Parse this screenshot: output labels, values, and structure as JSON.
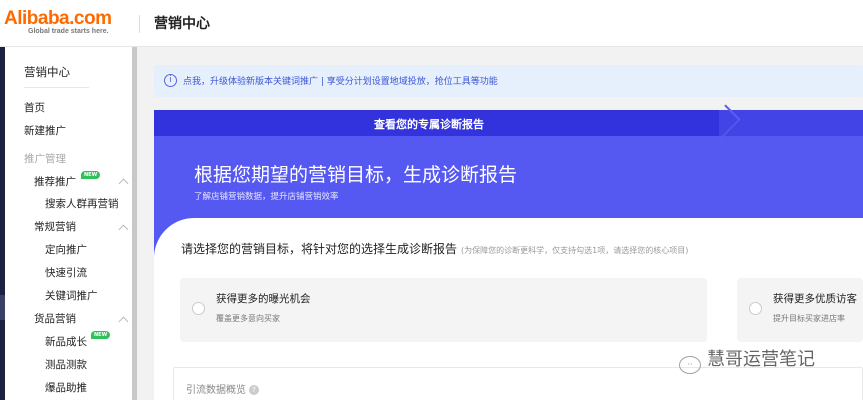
{
  "header": {
    "logo_brand": "Alibaba.com",
    "logo_tagline": "Global trade starts here.",
    "title": "营销中心"
  },
  "sidebar": {
    "title": "营销中心",
    "items": [
      {
        "label": "首页"
      },
      {
        "label": "新建推广"
      },
      {
        "label": "推广管理"
      },
      {
        "label": "推荐推广",
        "badge": "NEW"
      },
      {
        "label": "搜索人群再营销"
      },
      {
        "label": "常规营销"
      },
      {
        "label": "定向推广"
      },
      {
        "label": "快速引流"
      },
      {
        "label": "关键词推广"
      },
      {
        "label": "货品营销"
      },
      {
        "label": "新品成长",
        "badge": "NEW"
      },
      {
        "label": "测品测款"
      },
      {
        "label": "爆品助推"
      }
    ]
  },
  "banner": {
    "text": "点我，升级体验新版本关键词推广 | 享受分计划设置地域投放，抢位工具等功能"
  },
  "card": {
    "step_label": "查看您的专属诊断报告",
    "heading": "根据您期望的营销目标，生成诊断报告",
    "subheading": "了解店铺营销数据，提升店铺营销效率",
    "prompt": "请选择您的营销目标，将针对您的选择生成诊断报告",
    "prompt_note": "(为保障您的诊断更科学，仅支持勾选1项，请选择您的核心项目)",
    "options": [
      {
        "title": "获得更多的曝光机会",
        "desc": "覆盖更多意向买家"
      },
      {
        "title": "获得更多优质访客",
        "desc": "提升目标买家进店率"
      }
    ],
    "overview_title": "引流数据概览",
    "help_icon": "?"
  },
  "watermark": "慧哥运营笔记"
}
